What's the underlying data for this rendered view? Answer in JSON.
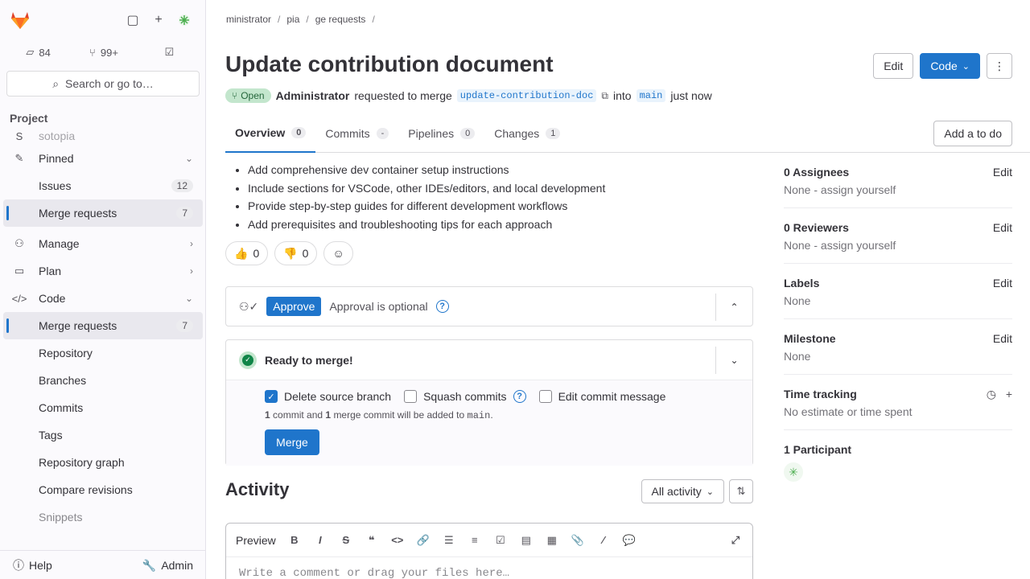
{
  "sidebar": {
    "counts": [
      {
        "icon": "issues-icon",
        "value": "84"
      },
      {
        "icon": "merge-request-icon",
        "value": "99+"
      },
      {
        "icon": "todo-icon",
        "value": ""
      }
    ],
    "search_label": "Search or go to…",
    "section_label": "Project",
    "nav": [
      {
        "name": "sidebar-item-project",
        "icon": "S",
        "label": "sotopia",
        "badge": null,
        "chev": null,
        "faded": true
      },
      {
        "name": "sidebar-item-pinned",
        "icon": "pin-icon",
        "label": "Pinned",
        "chev": "down"
      },
      {
        "name": "sidebar-item-issues",
        "label": "Issues",
        "badge": "12"
      },
      {
        "name": "sidebar-item-pinned-merge-requests",
        "label": "Merge requests",
        "badge": "7",
        "active": true
      },
      {
        "name": "sidebar-item-manage",
        "icon": "manage-icon",
        "label": "Manage",
        "chev": "right"
      },
      {
        "name": "sidebar-item-plan",
        "icon": "plan-icon",
        "label": "Plan",
        "chev": "right"
      },
      {
        "name": "sidebar-item-code",
        "icon": "code-icon",
        "label": "Code",
        "chev": "down"
      },
      {
        "name": "sidebar-item-merge-requests",
        "label": "Merge requests",
        "badge": "7",
        "active": true
      },
      {
        "name": "sidebar-item-repository",
        "label": "Repository"
      },
      {
        "name": "sidebar-item-branches",
        "label": "Branches"
      },
      {
        "name": "sidebar-item-commits",
        "label": "Commits"
      },
      {
        "name": "sidebar-item-tags",
        "label": "Tags"
      },
      {
        "name": "sidebar-item-repository-graph",
        "label": "Repository graph"
      },
      {
        "name": "sidebar-item-compare-revisions",
        "label": "Compare revisions"
      },
      {
        "name": "sidebar-item-snippets",
        "label": "Snippets",
        "faded": true
      }
    ],
    "help_label": "Help",
    "admin_label": "Admin"
  },
  "breadcrumb": [
    "ministrator",
    "pia",
    "ge requests",
    ""
  ],
  "title": "Update contribution document",
  "meta": {
    "status": "Open",
    "author": "Administrator",
    "requested_text": "requested to merge",
    "source_branch": "update-contribution-doc",
    "into_text": "into",
    "target_branch": "main",
    "time": "just now"
  },
  "header_actions": {
    "edit": "Edit",
    "code": "Code"
  },
  "tabs": [
    {
      "label": "Overview",
      "count": "0",
      "active": true
    },
    {
      "label": "Commits",
      "count": "-"
    },
    {
      "label": "Pipelines",
      "count": "0"
    },
    {
      "label": "Changes",
      "count": "1"
    }
  ],
  "todo_label": "Add a to do",
  "description": [
    "Add comprehensive dev container setup instructions",
    "Include sections for VSCode, other IDEs/editors, and local development",
    "Provide step-by-step guides for different development workflows",
    "Add prerequisites and troubleshooting tips for each approach"
  ],
  "reactions": {
    "thumbs_up": "0",
    "thumbs_down": "0"
  },
  "approval": {
    "button": "Approve",
    "text": "Approval is optional"
  },
  "merge": {
    "title": "Ready to merge!",
    "options": [
      {
        "label": "Delete source branch",
        "checked": true
      },
      {
        "label": "Squash commits",
        "checked": false
      },
      {
        "label": "Edit commit message",
        "checked": false
      }
    ],
    "note_commits": "1",
    "note_text_1": "commit and",
    "note_merge": "1",
    "note_text_2": "merge commit will be added to",
    "note_branch": "main",
    "note_end": ".",
    "button": "Merge"
  },
  "activity": {
    "title": "Activity",
    "filter": "All activity"
  },
  "comment": {
    "preview": "Preview",
    "placeholder": "Write a comment or drag your files here…"
  },
  "right_sidebar": {
    "assignees": {
      "title": "0 Assignees",
      "value": "None - assign yourself",
      "edit": "Edit"
    },
    "reviewers": {
      "title": "0 Reviewers",
      "value": "None - assign yourself",
      "edit": "Edit"
    },
    "labels": {
      "title": "Labels",
      "value": "None",
      "edit": "Edit"
    },
    "milestone": {
      "title": "Milestone",
      "value": "None",
      "edit": "Edit"
    },
    "time_tracking": {
      "title": "Time tracking",
      "value": "No estimate or time spent"
    },
    "participants": {
      "title": "1 Participant"
    }
  },
  "colors": {
    "accent": "#1f75cb",
    "success": "#108548",
    "open_pill_bg": "#c3e6cd"
  }
}
